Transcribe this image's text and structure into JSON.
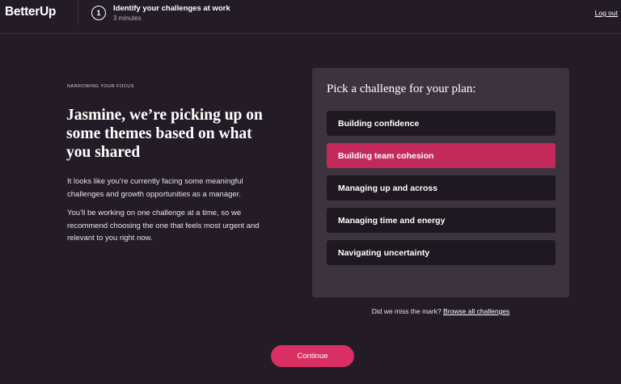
{
  "header": {
    "logo": "BetterUp",
    "step_number": "1",
    "step_title": "Identify your challenges at work",
    "step_duration": "3 minutes",
    "logout_label": "Log out"
  },
  "intro": {
    "eyebrow": "NARROWING YOUR FOCUS",
    "headline": "Jasmine, we’re picking up on some themes based on what you shared",
    "paragraph_1": "It looks like you’re currently facing some meaningful challenges and growth opportunities as a manager.",
    "paragraph_2": "You’ll be working on one challenge at a time, so we recommend choosing the one that feels most urgent and relevant to you right now."
  },
  "panel": {
    "title": "Pick a challenge for your plan:",
    "options": [
      {
        "label": "Building confidence",
        "selected": false
      },
      {
        "label": "Building team cohesion",
        "selected": true
      },
      {
        "label": "Managing up and across",
        "selected": false
      },
      {
        "label": "Managing time and energy",
        "selected": false
      },
      {
        "label": "Navigating uncertainty",
        "selected": false
      }
    ]
  },
  "footer": {
    "miss_text": "Did we miss the mark?",
    "browse_link": "Browse all challenges",
    "continue_label": "Continue"
  },
  "colors": {
    "background": "#231c26",
    "panel": "#3c333f",
    "option": "#1e1820",
    "accent": "#c32a5b",
    "button": "#d92f63"
  }
}
